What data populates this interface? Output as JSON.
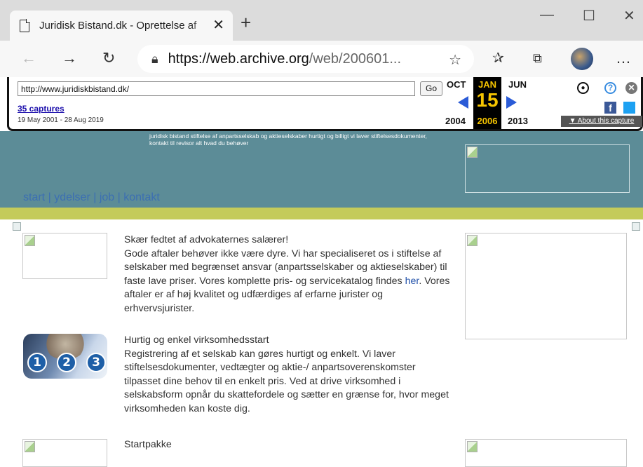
{
  "browser": {
    "tab_title": "Juridisk Bistand.dk - Oprettelse af",
    "tab_close": "✕",
    "new_tab": "+",
    "url_host": "https://web.archive.org",
    "url_path": "/web/200601...",
    "window_controls": {
      "minimize": "—",
      "maximize": "☐",
      "close": "✕"
    },
    "icons": [
      "back-arrow-icon",
      "forward-arrow-icon",
      "refresh-icon",
      "lock-icon",
      "star-icon",
      "favorites-icon",
      "collections-icon",
      "profile-avatar",
      "more-icon"
    ]
  },
  "wayback": {
    "url_value": "http://www.juridiskbistand.dk/",
    "go_label": "Go",
    "captures": "35 captures",
    "range": "19 May 2001 - 28 Aug 2019",
    "prev_month": "OCT",
    "cur_month": "JAN",
    "next_month": "JUN",
    "cur_day": "15",
    "prev_year": "2004",
    "cur_year": "2006",
    "next_year": "2013",
    "about": "▼ About this capture",
    "fb": "f"
  },
  "page": {
    "intro": "juridisk bistand stiftelse af anpartsselskab og aktieselskaber hurtigt og billigt vi laver stiftelsesdokumenter, kontakt til revisor alt hvad du behøver",
    "nav": [
      "start",
      "ydelser",
      "job",
      "kontakt"
    ],
    "sections": [
      {
        "heading": "Skær fedtet af advokaternes salærer!",
        "body_a": "Gode aftaler behøver ikke være dyre. Vi har specialiseret os i stiftelse af selskaber med begrænset ansvar (anpartsselskaber og aktieselskaber) til faste lave priser. Vores komplette pris- og servicekatalog findes ",
        "link": "her",
        "body_b": ". Vores aftaler er af høj kvalitet og udfærdiges af erfarne jurister og erhvervsjurister."
      },
      {
        "heading": "Hurtig og enkel virksomhedsstart",
        "body": "Registrering af et selskab kan gøres hurtigt og enkelt. Vi laver stiftelsesdokumenter, vedtægter og aktie-/ anpartsoverenskomster tilpasset dine behov til en enkelt pris. Ved at drive virksomhed i selskabsform opnår du skattefordele og sætter en grænse for, hvor meget virksomheden kan koste dig."
      },
      {
        "heading": "Startpakke"
      }
    ],
    "steps": [
      "1",
      "2",
      "3"
    ]
  }
}
